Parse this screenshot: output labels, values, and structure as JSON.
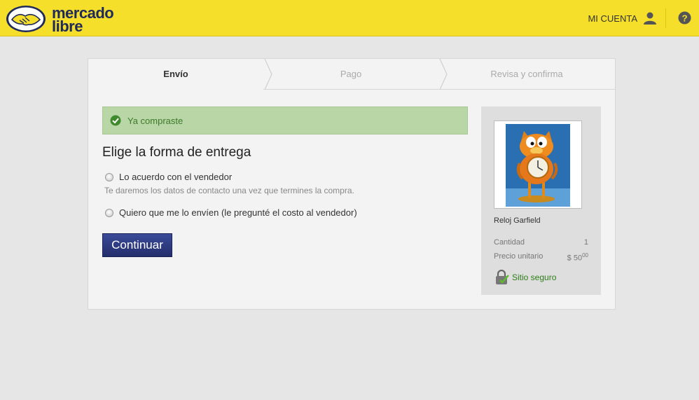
{
  "header": {
    "logo_line1": "mercado",
    "logo_line2": "libre",
    "account_label": "MI CUENTA"
  },
  "steps": [
    {
      "label": "Envío",
      "active": true
    },
    {
      "label": "Pago",
      "active": false
    },
    {
      "label": "Revisa y confirma",
      "active": false
    }
  ],
  "alert": {
    "text": "Ya compraste"
  },
  "delivery": {
    "title": "Elige la forma de entrega",
    "option1": "Lo acuerdo con el vendedor",
    "option1_hint": "Te daremos los datos de contacto una vez que termines la compra.",
    "option2": "Quiero que me lo envíen (le pregunté el costo al vendedor)",
    "continue_label": "Continuar"
  },
  "summary": {
    "item_name": "Reloj Garfield",
    "quantity_label": "Cantidad",
    "quantity_value": "1",
    "unit_price_label": "Precio unitario",
    "price_main": "$ 50",
    "price_cents": "00",
    "secure_label": "Sitio seguro"
  },
  "colors": {
    "header_bg": "#f6df2a",
    "button_bg": "#2d3a80",
    "alert_bg": "#b9d6a6",
    "secure_green": "#2d7d18"
  }
}
